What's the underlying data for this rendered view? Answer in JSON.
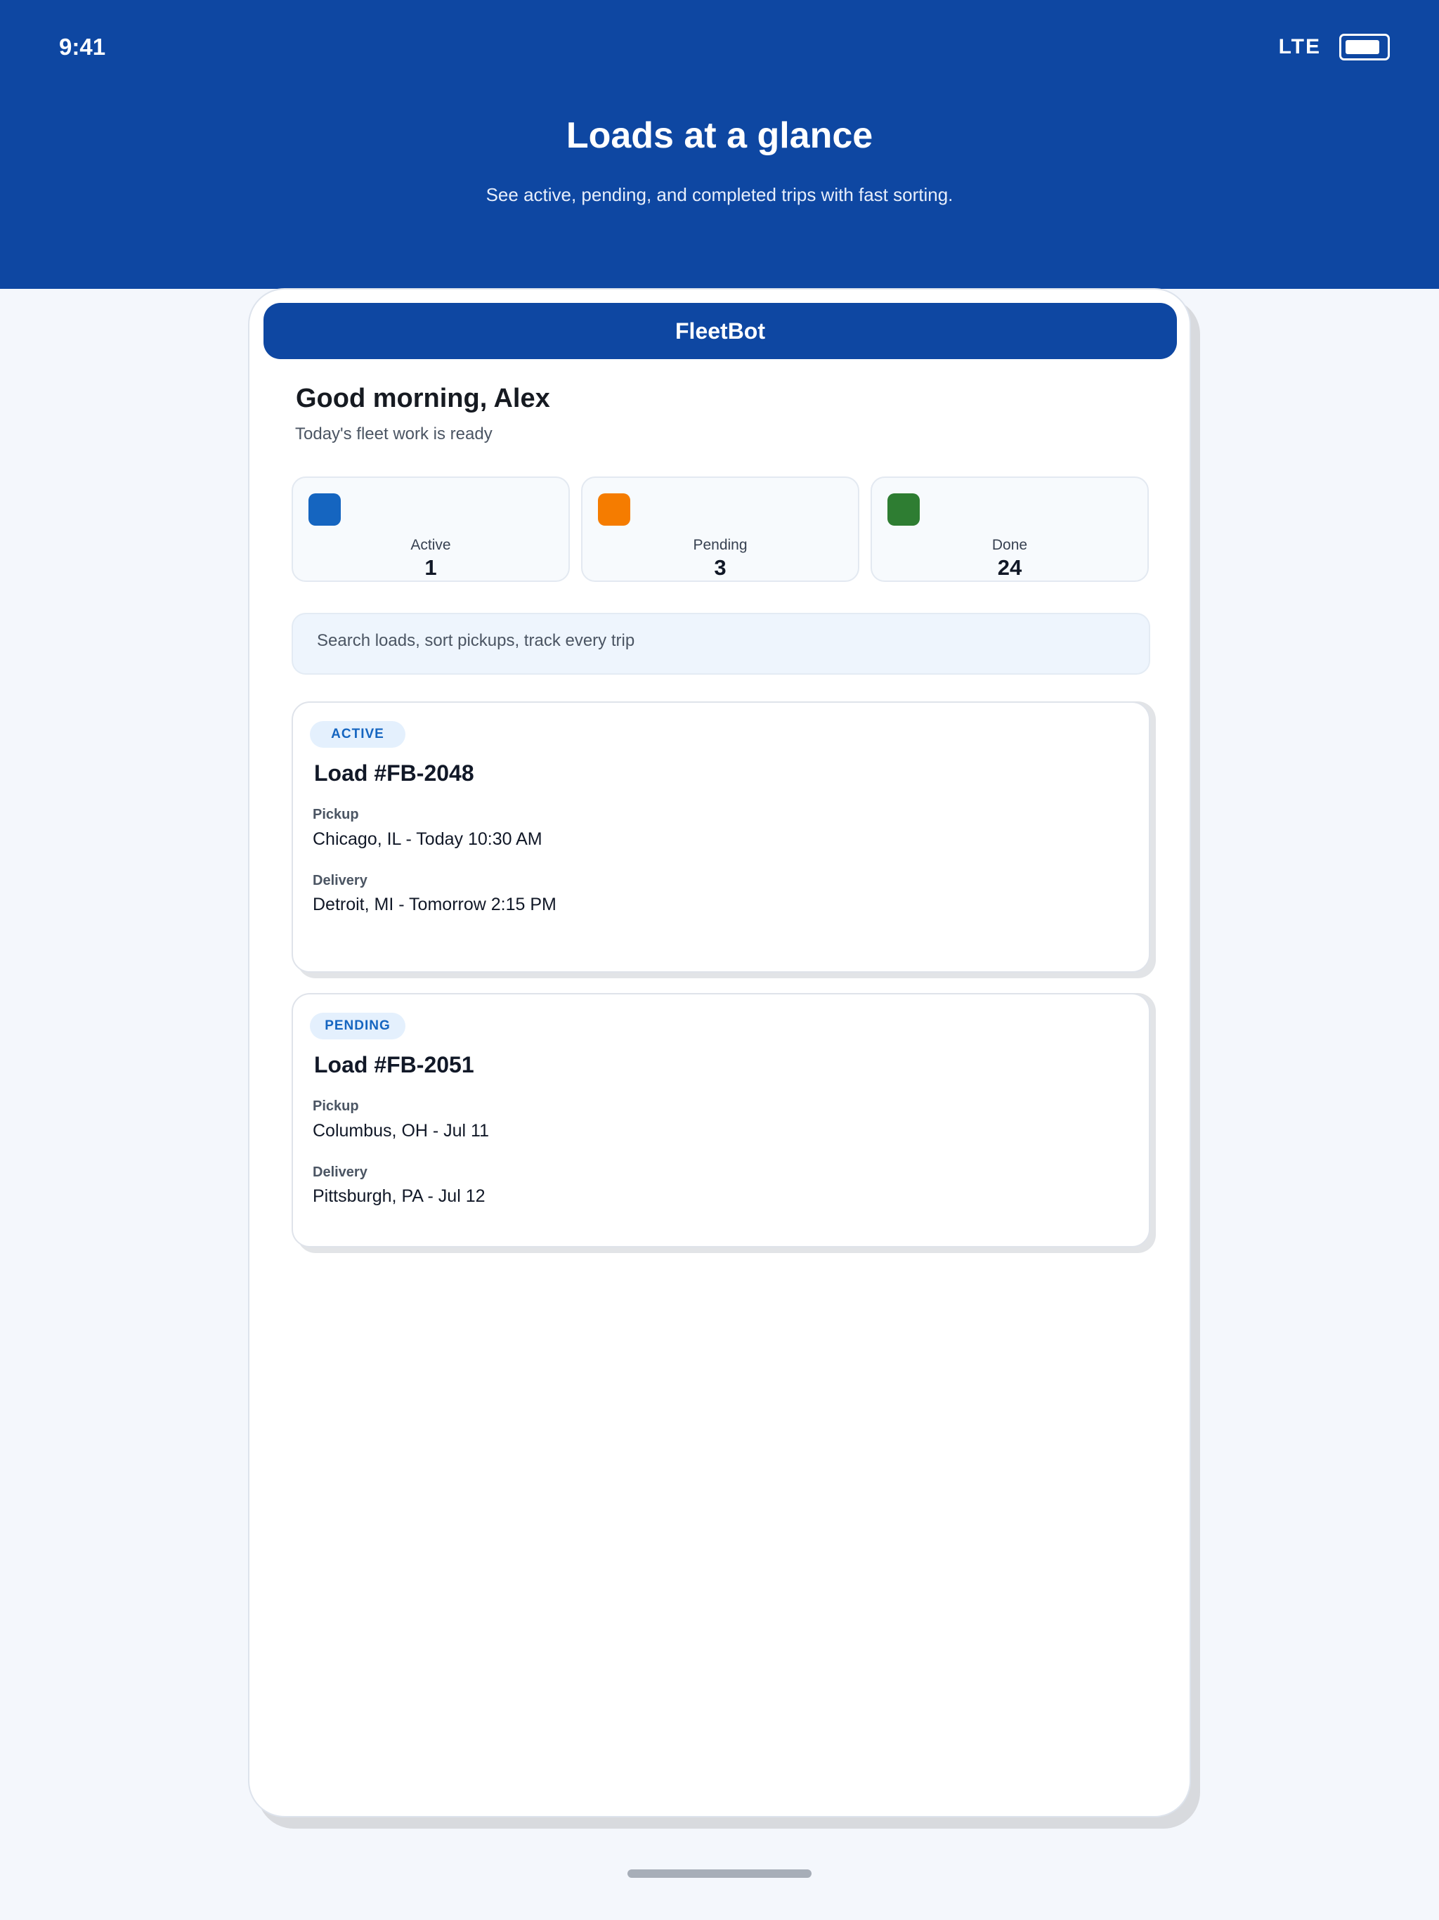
{
  "status_bar": {
    "time": "9:41",
    "network": "LTE",
    "battery_icon": "battery-icon"
  },
  "hero": {
    "title": "Loads at a glance",
    "subtitle": "See active, pending, and completed trips with fast sorting."
  },
  "app": {
    "name": "FleetBot",
    "greeting": "Good morning, Alex",
    "greeting_sub": "Today's fleet work is ready"
  },
  "stats": [
    {
      "label": "Active",
      "value": "1",
      "color": "#1565c0",
      "icon": "active-status-icon"
    },
    {
      "label": "Pending",
      "value": "3",
      "color": "#f57c00",
      "icon": "pending-status-icon"
    },
    {
      "label": "Done",
      "value": "24",
      "color": "#2e7d32",
      "icon": "done-status-icon"
    }
  ],
  "search": {
    "placeholder": "Search loads, sort pickups, track every trip"
  },
  "loads": [
    {
      "status": "ACTIVE",
      "title": "Load #FB-2048",
      "pickup_label": "Pickup",
      "pickup": "Chicago, IL - Today 10:30 AM",
      "delivery_label": "Delivery",
      "delivery": "Detroit, MI - Tomorrow 2:15 PM"
    },
    {
      "status": "PENDING",
      "title": "Load #FB-2051",
      "pickup_label": "Pickup",
      "pickup": "Columbus, OH - Jul 11",
      "delivery_label": "Delivery",
      "delivery": "Pittsburgh, PA - Jul 12"
    }
  ],
  "colors": {
    "brand": "#0e47a2",
    "badge_text": "#1565c0",
    "badge_bg": "#e4f0fd",
    "page_bg": "#f4f7fc"
  }
}
